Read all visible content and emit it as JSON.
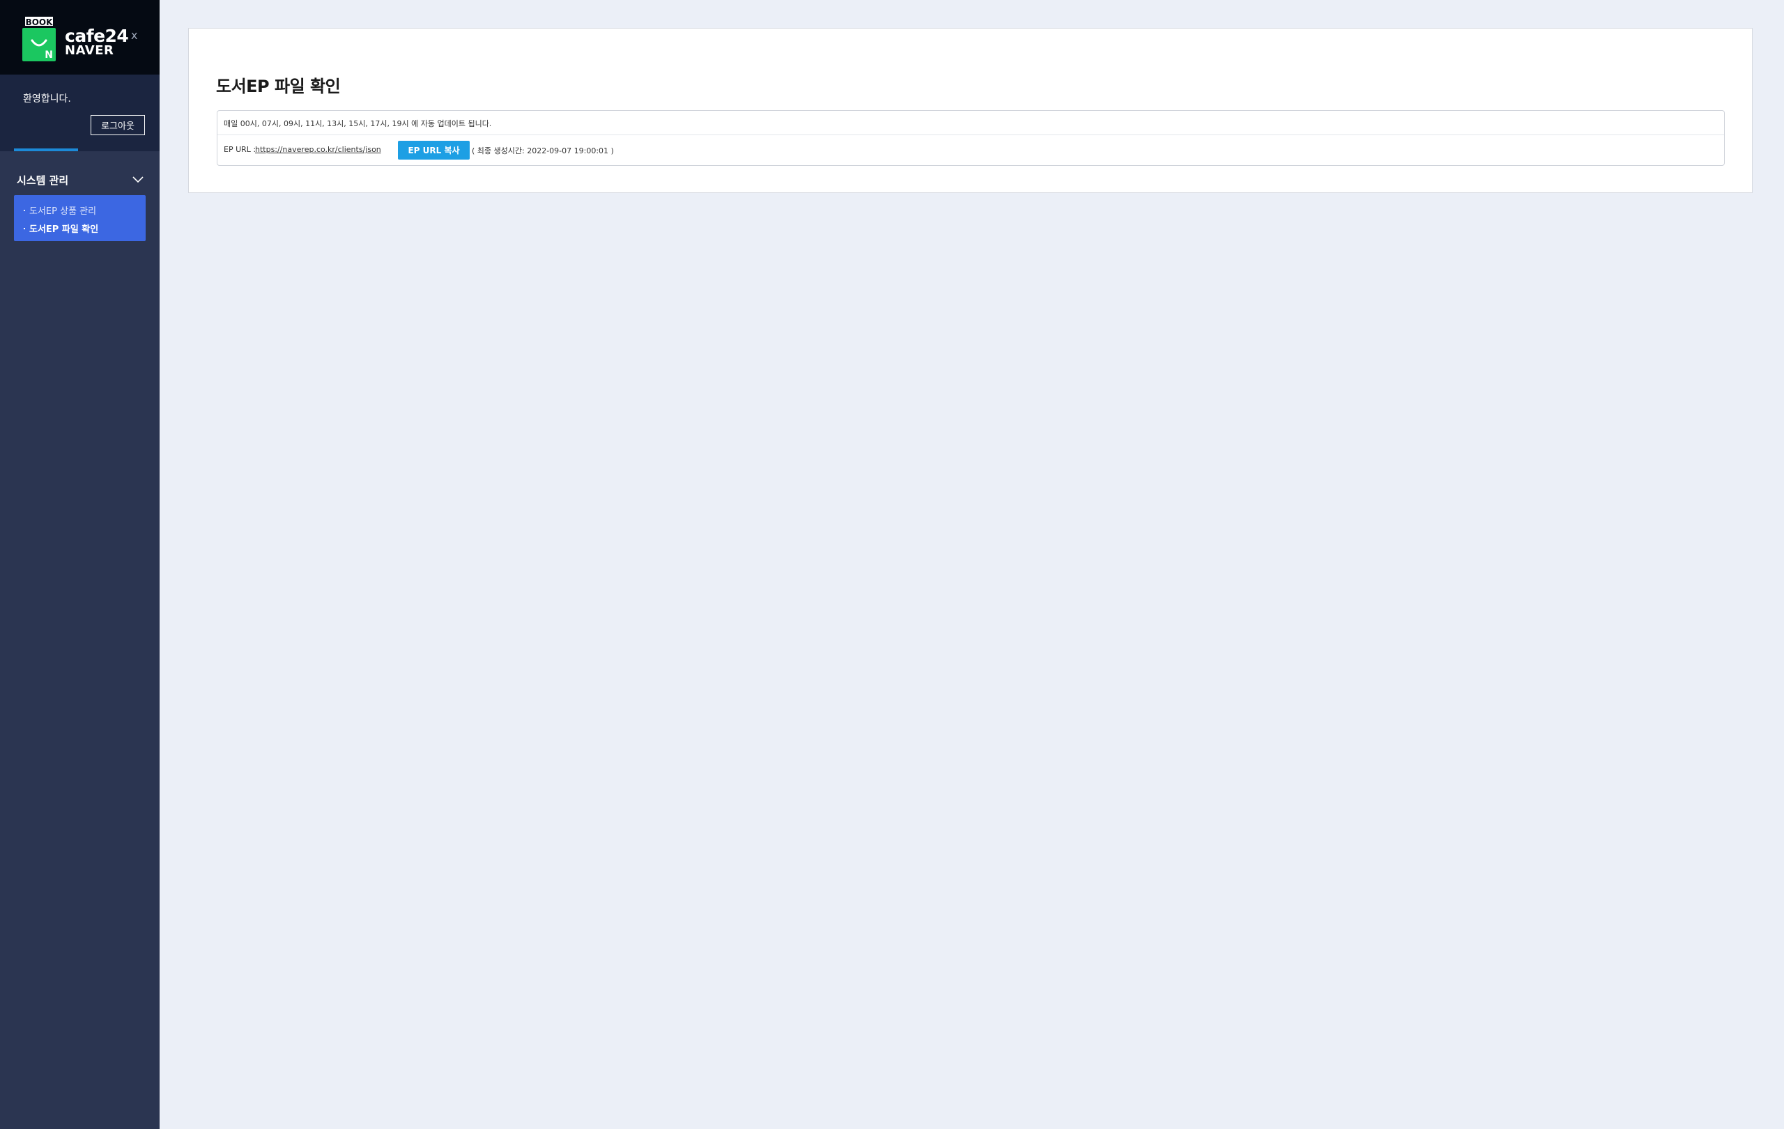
{
  "sidebar": {
    "logo": {
      "badge": "BOOK",
      "cafe": "cafe24",
      "naver": "NAVER",
      "bag_letter": "N",
      "close": "x"
    },
    "welcome": "환영합니다.",
    "logout_label": "로그아웃",
    "menu": {
      "title": "시스템 관리",
      "items": [
        {
          "label": "도서EP 상품 관리",
          "active": false
        },
        {
          "label": "도서EP 파일 확인",
          "active": true
        }
      ]
    }
  },
  "main": {
    "title": "도서EP 파일 확인",
    "schedule_text": "매일 00시, 07시, 09시, 11시, 13시, 15시, 17시, 19시 에 자동 업데이트 됩니다.",
    "ep_label": "EP URL :",
    "ep_url": "https://naverep.co.kr/clients/json",
    "copy_button_label": "EP URL 복사",
    "generated_text": "( 최종 생성시간: 2022-09-07 19:00:01 )"
  },
  "colors": {
    "sidebar_bg": "#2b3551",
    "header_bg": "#050a13",
    "accent_green": "#1bc760",
    "submenu_bg": "#3c67e2",
    "button_blue": "#1d9fe4",
    "page_bg": "#ebeff7"
  }
}
